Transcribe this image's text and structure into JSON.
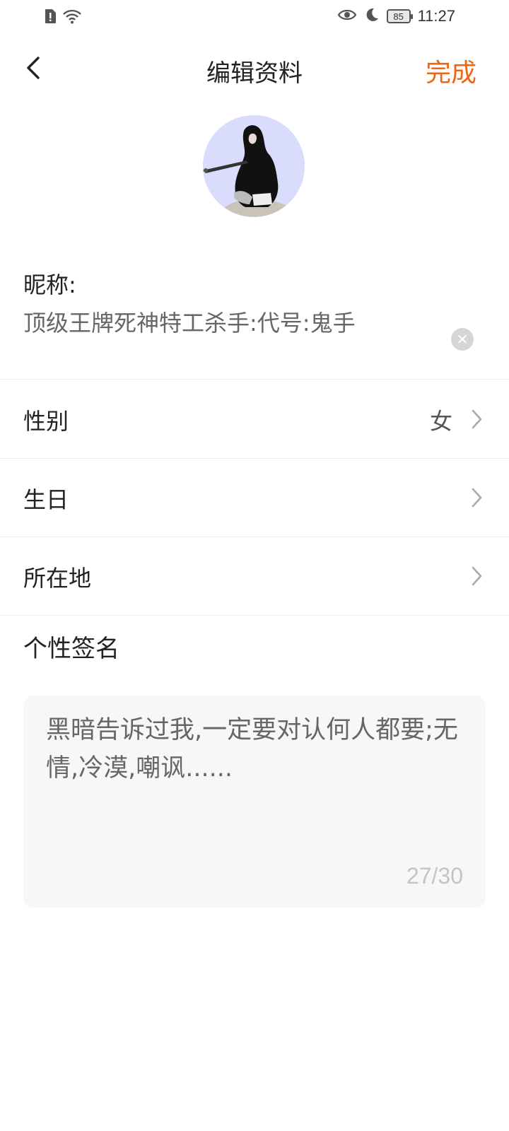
{
  "status_bar": {
    "time": "11:27",
    "battery": "85",
    "icons": [
      "alert-sim-icon",
      "wifi-icon",
      "eye-icon",
      "moon-icon",
      "battery-icon"
    ]
  },
  "header": {
    "title": "编辑资料",
    "done_label": "完成",
    "done_color": "#f26412"
  },
  "profile": {
    "nickname_label": "昵称:",
    "nickname_value": "顶级王牌死神特工杀手:代号:鬼手",
    "gender_label": "性别",
    "gender_value": "女",
    "birthday_label": "生日",
    "location_label": "所在地",
    "signature_label": "个性签名",
    "signature_value": "黑暗告诉过我,一定要对认何人都要;无情,冷漠,嘲讽......",
    "signature_count": "27/30"
  }
}
